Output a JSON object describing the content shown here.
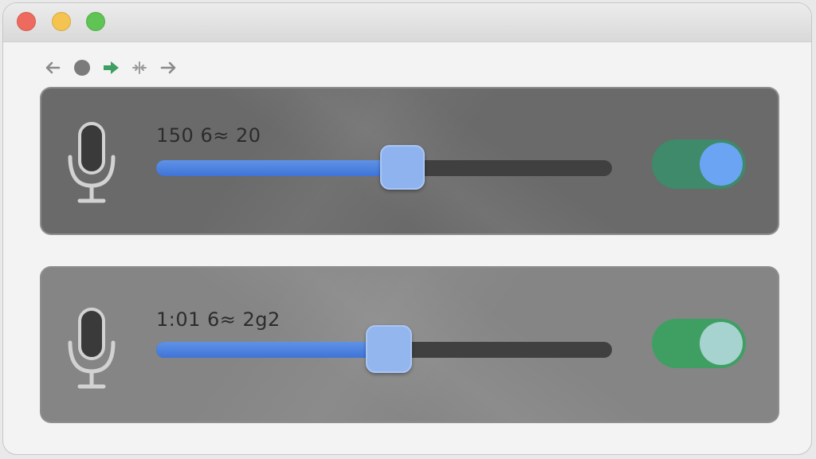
{
  "window": {
    "controls": [
      "close-button",
      "minimize-button",
      "zoom-button"
    ],
    "colors": {
      "close": "#ee6a5f",
      "minimize": "#f4c350",
      "zoom": "#5fc454"
    }
  },
  "toolbar": {
    "icons": [
      "back-arrow-icon",
      "record-dot-icon",
      "forward-arrow-icon",
      "split-icon",
      "next-arrow-icon"
    ],
    "accent": "#3f9f63"
  },
  "channels": [
    {
      "icon": "microphone-icon",
      "readout": "150  6≈ 20",
      "slider_level": 0.54,
      "toggle_on": true,
      "colors": {
        "track": "#404040",
        "fill": "#3f74d8",
        "thumb": "#8fb3ee",
        "toggle": "#3e8a6a",
        "knob": "#6aa4f3"
      }
    },
    {
      "icon": "microphone-icon",
      "readout": "1:01  6≈ 2g2",
      "slider_level": 0.51,
      "toggle_on": true,
      "colors": {
        "track": "#404040",
        "fill": "#3f74d8",
        "thumb": "#93b6ee",
        "toggle": "#3f9f63",
        "knob": "#a6d3cf"
      }
    }
  ]
}
